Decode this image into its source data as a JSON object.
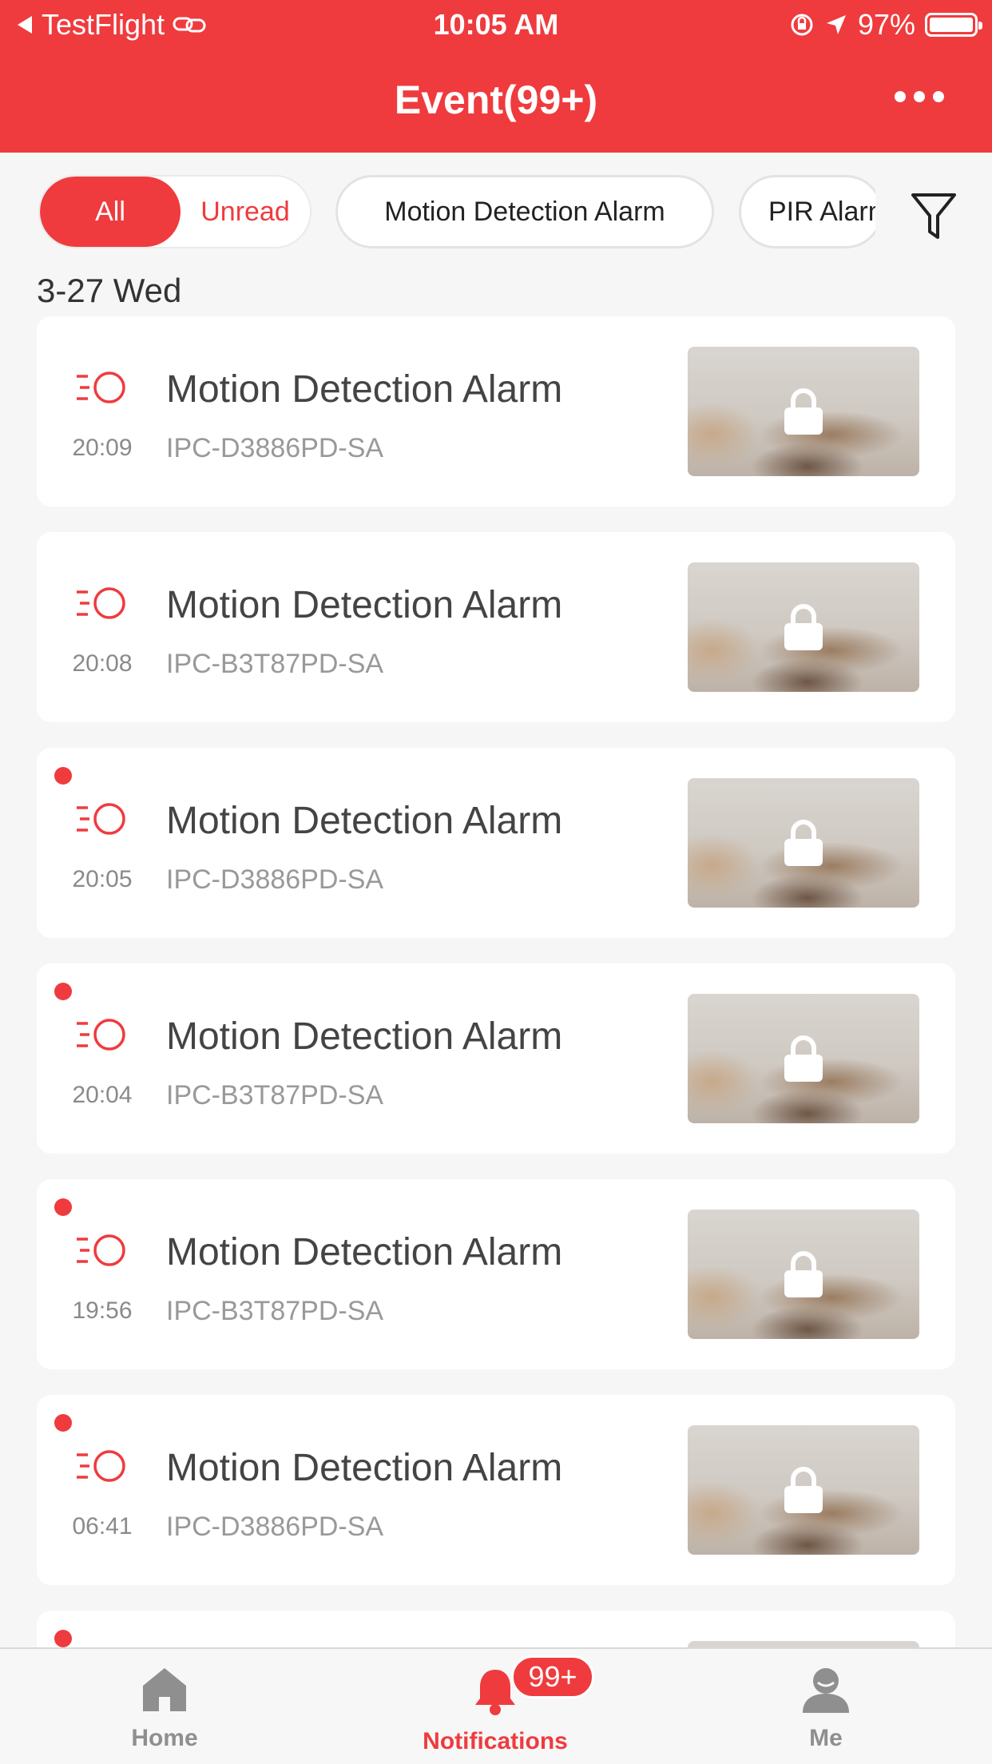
{
  "status_bar": {
    "back_app": "TestFlight",
    "time": "10:05 AM",
    "battery": "97%"
  },
  "header": {
    "title": "Event(99+)"
  },
  "filters": {
    "all": "All",
    "unread": "Unread",
    "motion": "Motion Detection Alarm",
    "pir": "PIR Alarm"
  },
  "date_header": "3-27 Wed",
  "events": [
    {
      "title": "Motion Detection Alarm",
      "device": "IPC-D3886PD-SA",
      "time": "20:09",
      "unread": false
    },
    {
      "title": "Motion Detection Alarm",
      "device": "IPC-B3T87PD-SA",
      "time": "20:08",
      "unread": false
    },
    {
      "title": "Motion Detection Alarm",
      "device": "IPC-D3886PD-SA",
      "time": "20:05",
      "unread": true
    },
    {
      "title": "Motion Detection Alarm",
      "device": "IPC-B3T87PD-SA",
      "time": "20:04",
      "unread": true
    },
    {
      "title": "Motion Detection Alarm",
      "device": "IPC-B3T87PD-SA",
      "time": "19:56",
      "unread": true
    },
    {
      "title": "Motion Detection Alarm",
      "device": "IPC-D3886PD-SA",
      "time": "06:41",
      "unread": true
    }
  ],
  "tabbar": {
    "home": "Home",
    "notifications": "Notifications",
    "me": "Me",
    "badge": "99+"
  },
  "colors": {
    "accent": "#ef3b3e",
    "background": "#f6f6f6",
    "card": "#ffffff"
  },
  "icons": [
    "back-arrow-icon",
    "link-icon",
    "rotation-lock-icon",
    "location-icon",
    "battery-icon",
    "more-icon",
    "filter-icon",
    "motion-event-icon",
    "lock-icon",
    "home-icon",
    "bell-icon",
    "person-icon"
  ]
}
